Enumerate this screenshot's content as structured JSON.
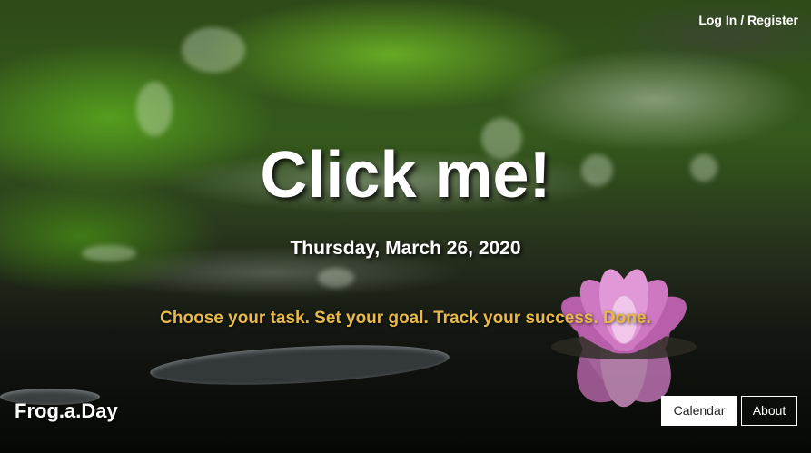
{
  "nav": {
    "login_register": "Log In / Register"
  },
  "hero": {
    "title": "Click me!",
    "date": "Thursday, March 26, 2020",
    "tagline": "Choose your task. Set your goal. Track your success. Done."
  },
  "footer": {
    "brand": "Frog.a.Day",
    "calendar_label": "Calendar",
    "about_label": "About"
  },
  "colors": {
    "tagline": "#e8b84a",
    "text": "#ffffff",
    "lotus": "#d67ac8"
  }
}
